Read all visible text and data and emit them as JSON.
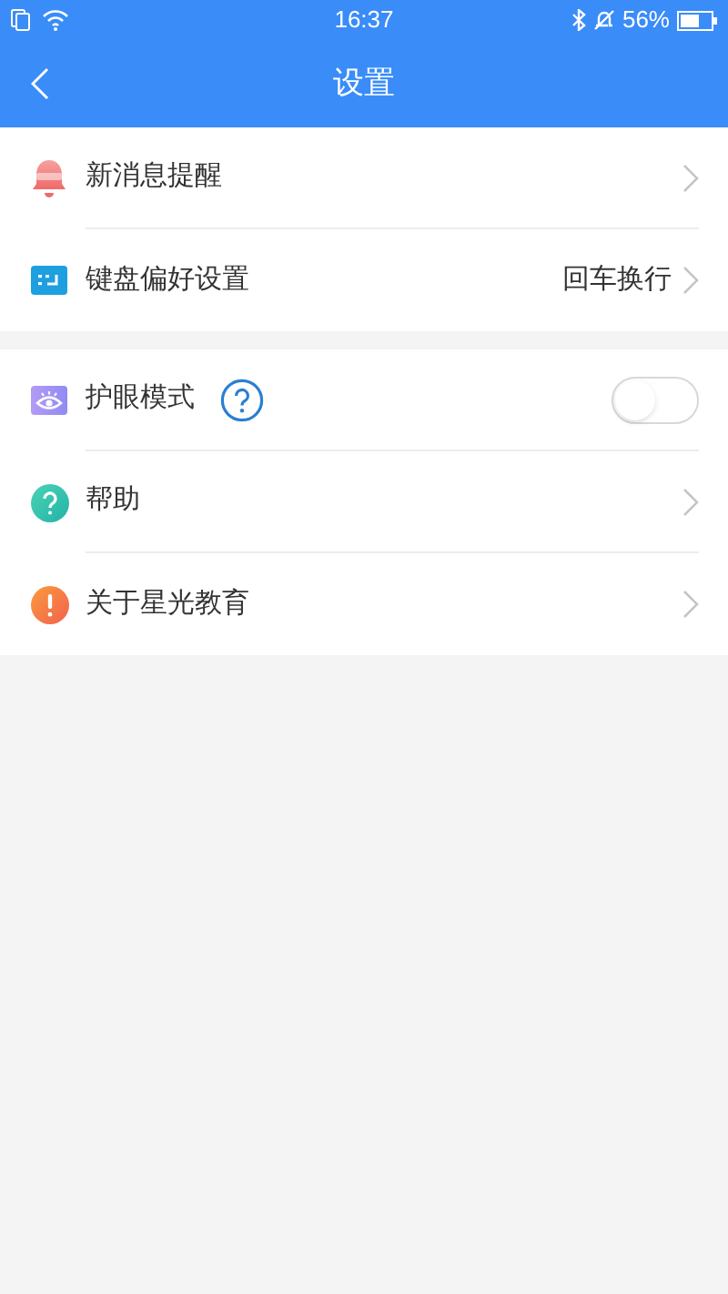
{
  "status_bar": {
    "time": "16:37",
    "battery": "56%"
  },
  "header": {
    "title": "设置"
  },
  "sections": [
    {
      "items": [
        {
          "kind": "link",
          "label": "新消息提醒"
        },
        {
          "kind": "link",
          "label": "键盘偏好设置",
          "value": "回车换行"
        }
      ]
    },
    {
      "items": [
        {
          "kind": "toggle",
          "label": "护眼模式",
          "on": false
        },
        {
          "kind": "link",
          "label": "帮助"
        },
        {
          "kind": "link",
          "label": "关于星光教育"
        }
      ]
    }
  ]
}
